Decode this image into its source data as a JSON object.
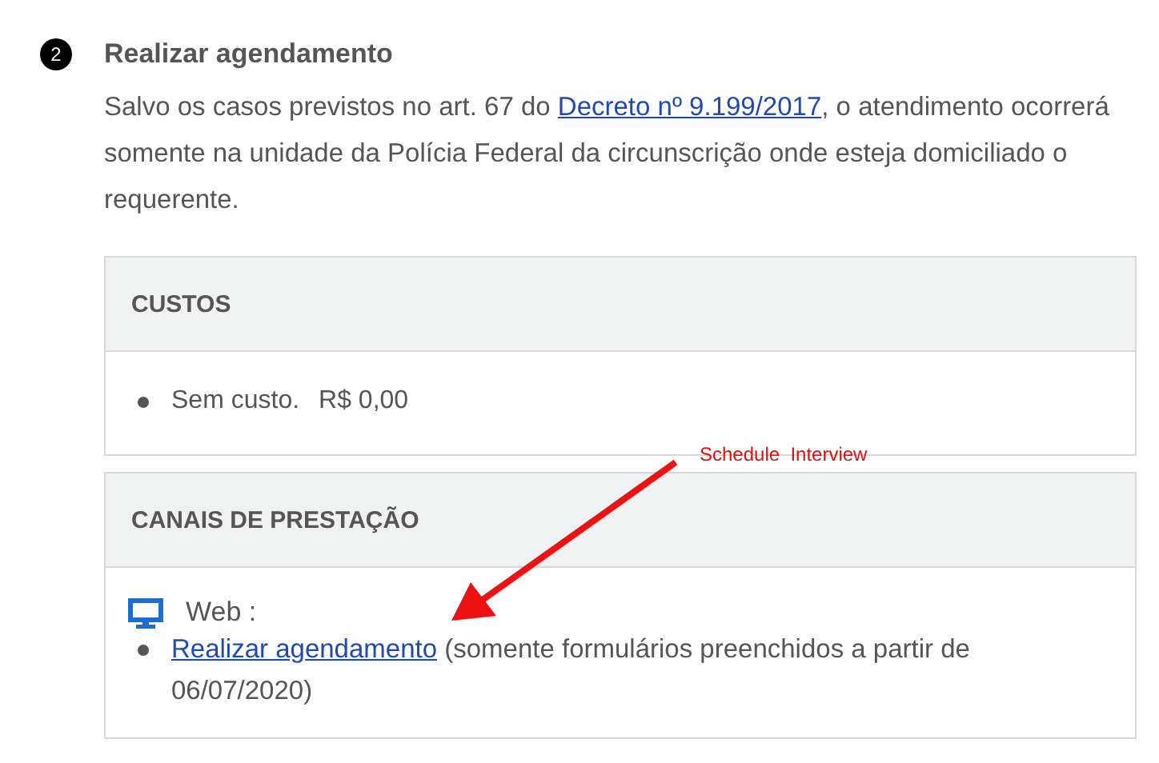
{
  "step": {
    "number": "2",
    "title": "Realizar agendamento",
    "description": {
      "before": "Salvo os casos previstos no art. 67 do ",
      "link": "Decreto nº 9.199/2017",
      "after": ", o atendimento ocorrerá somente na unidade da Polícia Federal da circunscrição onde esteja domiciliado o requerente."
    }
  },
  "costs": {
    "heading": "CUSTOS",
    "items": [
      {
        "label": "Sem custo.",
        "value": "R$ 0,00"
      }
    ]
  },
  "channels": {
    "heading": "CANAIS DE PRESTAÇÃO",
    "items": [
      {
        "kind": "web",
        "label": "Web :",
        "links": [
          {
            "link": "Realizar agendamento",
            "note": " (somente formulários preenchidos a partir de 06/07/2020)"
          }
        ]
      }
    ]
  },
  "annotation": {
    "text": "Schedule  Interview"
  }
}
